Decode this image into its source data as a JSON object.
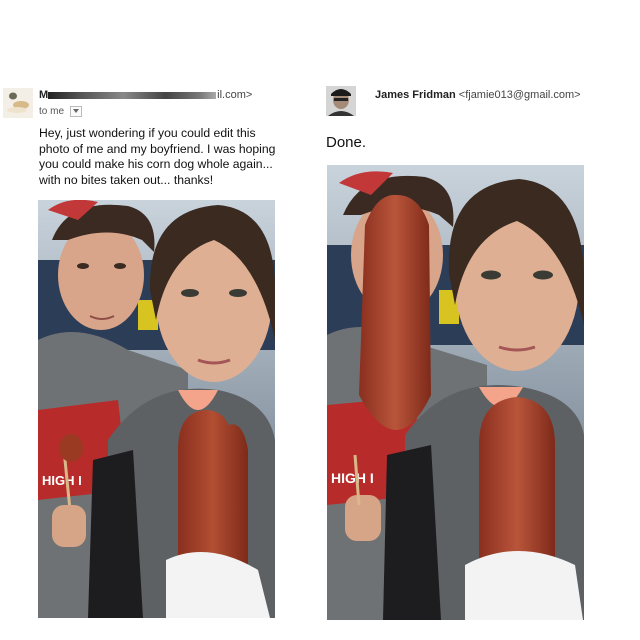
{
  "original_email": {
    "sender_name_suffix": "il.com>",
    "recipient_label": "to me",
    "body_lines": [
      "Hey, just wondering if you could edit this",
      "photo of me and my boyfriend. I was hoping",
      "you could make his corn dog whole again...",
      "with no bites taken out... thanks!"
    ]
  },
  "reply_email": {
    "sender_name": "James Fridman",
    "sender_email": "<fjamie013@gmail.com>",
    "body": "Done."
  },
  "icons": {
    "recipient_dropdown": "chevron-down-icon"
  },
  "colors": {
    "corndog": "#a9432a",
    "shirt_gray": "#6b6f70",
    "background": "#ffffff"
  }
}
